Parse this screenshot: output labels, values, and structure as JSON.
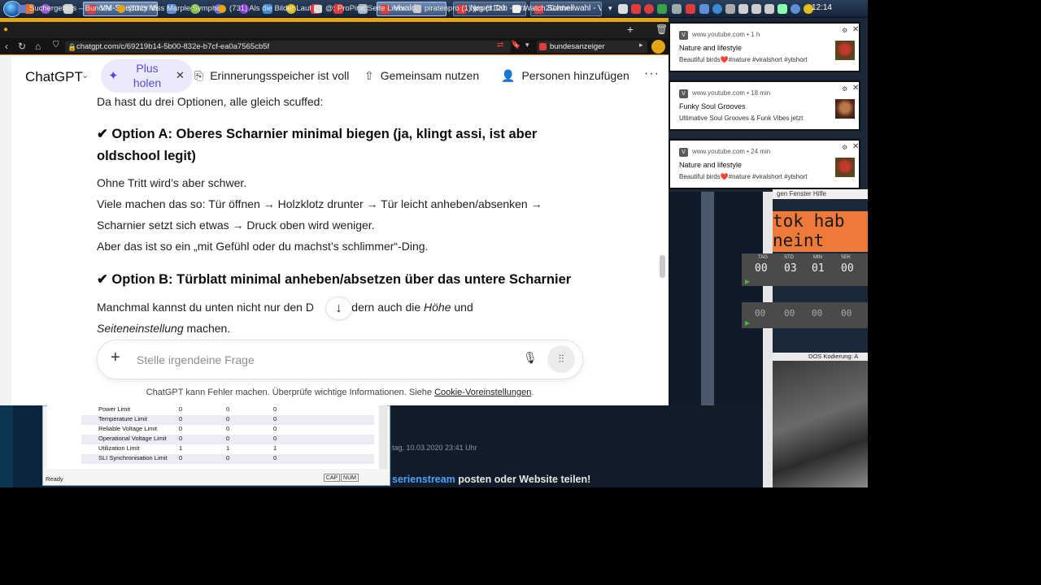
{
  "taskbar": {
    "tasks": [
      {
        "label": "VM-Streamer Vie...",
        "active": true
      },
      {
        "label": "Vivaldi",
        "active": true
      },
      {
        "label": "Neuer Tab - Brave",
        "active": false
      },
      {
        "label": "Schnellwahl - Viv...",
        "active": false
      }
    ],
    "clock": "12:14"
  },
  "browser": {
    "tabs": [
      "Suchergebnis – Bundesanzeiger",
      "(731) Miss Marple Symphon",
      "(731) Als die Bilder Laufen le",
      "@: ProPirat Seite Links aktu",
      "piratenpro (1).jpg (3120×41",
      "Watch2Gether"
    ],
    "url": "chatgpt.com/c/69219b14-5b00-832e-b7cf-ea0a7565cb5f",
    "bookmark_field": "bundesanzeiger"
  },
  "chatgpt": {
    "brand": "ChatGPT",
    "plus_label": "Plus holen",
    "memory_label": "Erinnerungsspeicher ist voll",
    "share_label": "Gemeinsam nutzen",
    "add_people_label": "Personen hinzufügen",
    "content": {
      "intro": "Da hast du drei Optionen, alle gleich scuffed:",
      "option_a_heading_1": "✔ Option A: Oberes Scharnier minimal biegen (ja, klingt assi, ist aber",
      "option_a_heading_2": "oldschool legit)",
      "option_a_lines": [
        "Ohne Tritt wird’s aber schwer.",
        "Viele machen das so: Tür öffnen → Holzklotz drunter → Tür leicht anheben/absenken →",
        "Scharnier setzt sich etwas → Druck oben wird weniger.",
        "Aber das ist so ein „mit Gefühl oder du machst’s schlimmer“-Ding."
      ],
      "option_b_heading": "✔ Option B: Türblatt minimal anheben/absetzen über das untere Scharnier",
      "option_b_line1_start": "Manchmal kannst du unten nicht nur den D",
      "option_b_line1_end": ", sondern auch die ",
      "option_b_line1_italic": "Höhe",
      "option_b_line1_tail": " und",
      "option_b_line2_italic": "Seiteneinstellung",
      "option_b_line2_tail": " machen."
    },
    "composer_placeholder": "Stelle irgendeine Frage",
    "disclaimer": "ChatGPT kann Fehler machen. Überprüfe wichtige Informationen. Siehe ",
    "disclaimer_link": "Cookie-Voreinstellungen",
    "disclaimer_end": "."
  },
  "notifications": [
    {
      "source": "www.youtube.com",
      "age": "1 h",
      "title": "Nature and lifestyle",
      "body": "Beautiful birds❤️#nature #viralshort #ytshort"
    },
    {
      "source": "www.youtube.com",
      "age": "18 min",
      "title": "Funky Soul Grooves",
      "body": "Ultimative Soul Grooves & Funk Vibes jetzt"
    },
    {
      "source": "www.youtube.com",
      "age": "24 min",
      "title": "Nature and lifestyle",
      "body": "Beautiful birds❤️#nature #viralshort #ytshort"
    }
  ],
  "background": {
    "menu": "gen   Fenster   Hilfe",
    "orange_line1": "tok hab",
    "orange_line2": "neint",
    "timer1": {
      "labels": [
        "TAG",
        "STD",
        "MIN",
        "SEK"
      ],
      "values": [
        "00",
        "03",
        "01",
        "00"
      ]
    },
    "timer2": {
      "values": [
        "00",
        "00",
        "00",
        "00"
      ]
    },
    "status": "DOS    Kodierung: A",
    "table_rows": [
      {
        "name": "Power Limit",
        "v": [
          "0",
          "0",
          "0"
        ]
      },
      {
        "name": "Temperature Limit",
        "v": [
          "0",
          "0",
          "0"
        ]
      },
      {
        "name": "Reliable Voltage Limit",
        "v": [
          "0",
          "0",
          "0"
        ]
      },
      {
        "name": "Operational Voltage Limit",
        "v": [
          "0",
          "0",
          "0"
        ]
      },
      {
        "name": "Utilization Limit",
        "v": [
          "1",
          "1",
          "1"
        ]
      },
      {
        "name": "SLI Synchronisation Limit",
        "v": [
          "0",
          "0",
          "0"
        ]
      }
    ],
    "window_status": "Ready",
    "cap": "CAP",
    "num": "NUM",
    "date_text": "tag, 10.03.2020 23:41 Uhr",
    "bottom_link": "serienstream",
    "bottom_text": " posten oder Website teilen!"
  }
}
